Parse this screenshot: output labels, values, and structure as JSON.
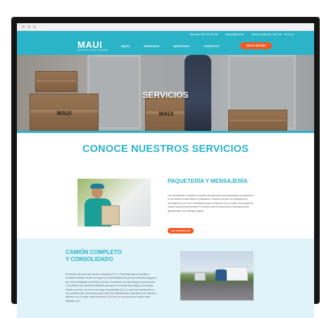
{
  "topbar": {
    "phone": "Llámanos: 800 475 023 030",
    "email": "soporte@maui.mx",
    "hours": "Horario de Atención: 8:00 a.m. - 8:00 p.m."
  },
  "header": {
    "logo": "MAUI",
    "tagline": "Especialistas en Logística y Transportación",
    "nav": [
      "INICIO",
      "SERVICIOS",
      "NOSOTROS",
      "CONTACTO"
    ],
    "cta": "INICIA SESIÓN"
  },
  "hero": {
    "title": "SERVICIOS",
    "box_label": "MAUI"
  },
  "main": {
    "section_title": "CONOCE NUESTROS SERVICIOS"
  },
  "service1": {
    "title": "PAQUETERÍA Y MENSAJERÍA",
    "text": "Les brindamos a nuestros clientes una atención personalizada y profesional si necesitan enviar sobres o paquetes. Nuestro servicio de paquetería y mensajería es el más confiable porque contamos con la mejor tecnología de rastreo para proporcionarte en tiempo real la información necesaria para garantizarte una entrega segura.",
    "button": "MÁS INFORMACIÓN"
  },
  "service2": {
    "title_line1": "CAMIÓN COMPLETO",
    "title_line2": "Y CONSOLIDADO",
    "text": "El servicio de envío de camión completo (FTL o Full truckload) te permite a nuestros clientes enviar su carga con la flexibilidad de que se encuentra segura y que será entregada en tiempo y forma. Contamos con tecnología de punta para el monitoreo de nuestras unidades para que tu entrega sea segura y a tiempo. Nuestro servicio de envío de carga consolidada (LCL o Less than truckload) es una solución que ofrecemos para cubrir las necesidades específicas de nuestros clientes con el mejor costo-beneficio. El envío de mercancía se realiza más eficiente con"
  },
  "colors": {
    "brand": "#2bb3c8",
    "accent": "#f15a22",
    "light_section": "#dff3f8"
  }
}
